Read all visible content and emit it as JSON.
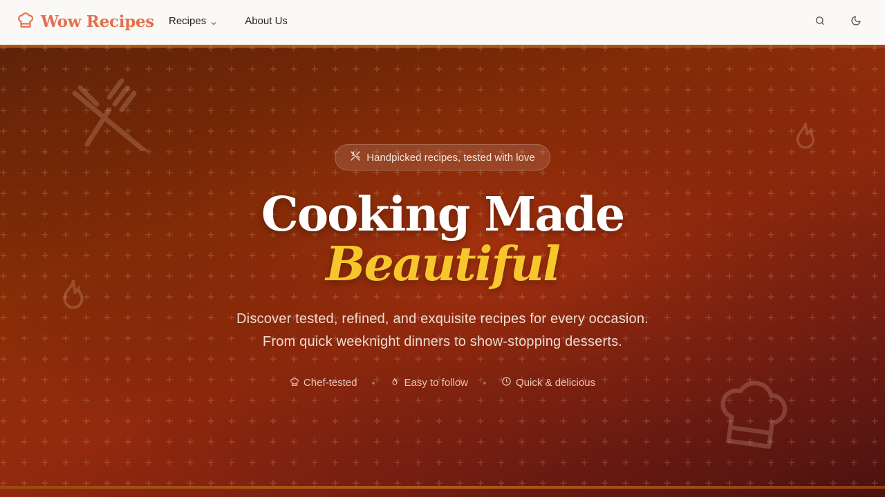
{
  "header": {
    "brand": "Wow Recipes",
    "nav": [
      {
        "label": "Recipes",
        "has_dropdown": true
      },
      {
        "label": "About Us",
        "has_dropdown": false
      }
    ],
    "icons": {
      "search": "search-icon",
      "theme": "moon-icon"
    }
  },
  "hero": {
    "badge": "Handpicked recipes, tested with love",
    "title_line1": "Cooking Made",
    "title_line2": "Beautiful",
    "subtitle_line1": "Discover tested, refined, and exquisite recipes for every occasion.",
    "subtitle_line2": "From quick weeknight dinners to show-stopping desserts.",
    "features": [
      {
        "label": "Chef-tested",
        "icon": "chef-hat-icon"
      },
      {
        "label": "Easy to follow",
        "icon": "flame-icon"
      },
      {
        "label": "Quick & delicious",
        "icon": "clock-icon"
      }
    ]
  },
  "colors": {
    "brand": "#e2714d",
    "accent": "#f7c62c",
    "hero_dark": "#5e2208",
    "hero_mid": "#942a0d"
  }
}
